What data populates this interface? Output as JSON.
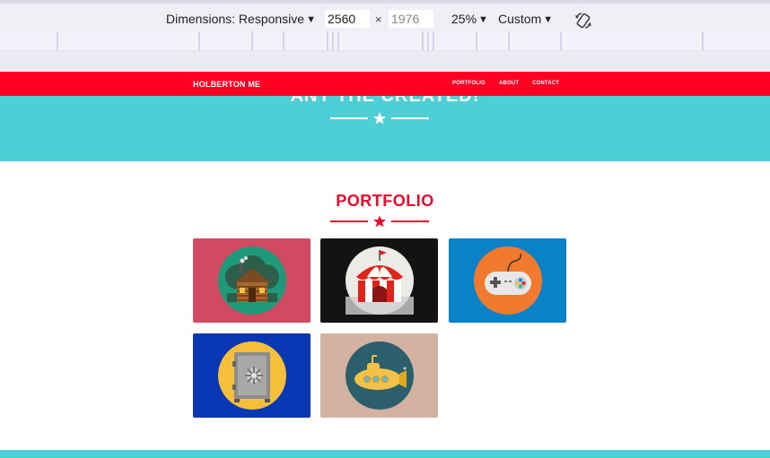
{
  "devtools": {
    "dimensions_label": "Dimensions: Responsive",
    "width_value": "2560",
    "height_value": "1976",
    "times": "×",
    "zoom": "25%",
    "throttle": "Custom",
    "caret": "▼"
  },
  "site": {
    "brand": "HOLBERTON ME",
    "nav": [
      "PORTFOLIO",
      "ABOUT",
      "CONTACT"
    ],
    "hero_title": "ANY THE CREATED!",
    "portfolio_title": "PORTFOLIO"
  },
  "portfolio": {
    "items": [
      {
        "name": "cabin",
        "bg": "#d04a62"
      },
      {
        "name": "circus-tent",
        "bg": "#141212"
      },
      {
        "name": "game-controller",
        "bg": "#0a82c8"
      },
      {
        "name": "safe",
        "bg": "#0a37b4"
      },
      {
        "name": "submarine",
        "bg": "#d4b2a2"
      }
    ]
  },
  "colors": {
    "nav_red": "#ff0022",
    "accent_red": "#ec0a2c",
    "teal": "#4ecfd5"
  }
}
